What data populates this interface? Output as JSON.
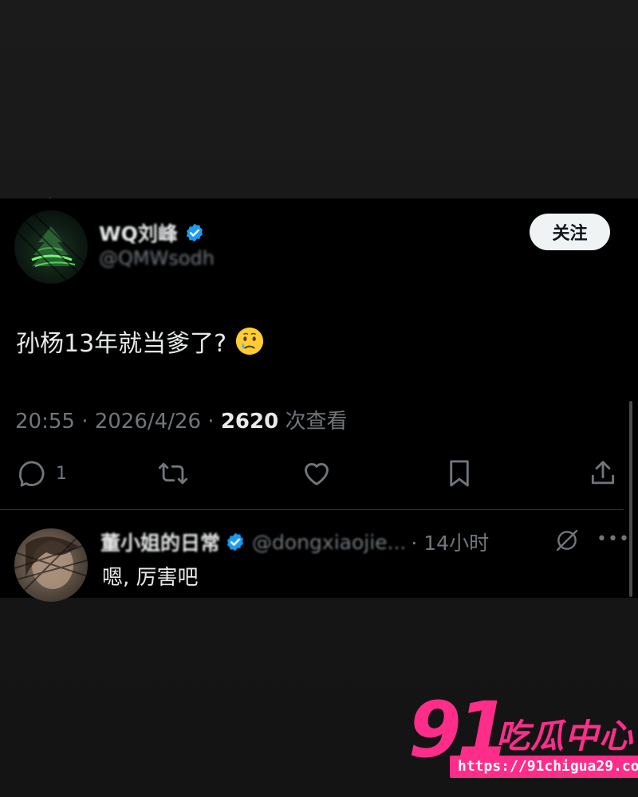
{
  "tweet": {
    "author_name": "WQ刘峰",
    "author_handle": "@QMWsodh",
    "follow_label": "关注",
    "text": "孙杨13年就当爹了?",
    "meta_time": "20:55 · 2026/4/26 · ",
    "meta_views": "2620",
    "meta_views_suffix": " 次查看",
    "reply_count": "1",
    "emoji": "face-holding-back-tears"
  },
  "reply": {
    "author_name": "董小姐的日常",
    "author_handle": "@dongxiaojie...",
    "time": "· 14小时",
    "more": "•••",
    "text": "嗯, 厉害吧"
  },
  "watermark": {
    "number": "91",
    "name": "吃瓜中心",
    "url": "https://91chigua29.com"
  },
  "colors": {
    "background": "#181818",
    "card": "#000000",
    "text": "#e7e9ea",
    "muted": "#71767b",
    "verified": "#1d9bf0",
    "watermark": "#ff2d8a"
  }
}
